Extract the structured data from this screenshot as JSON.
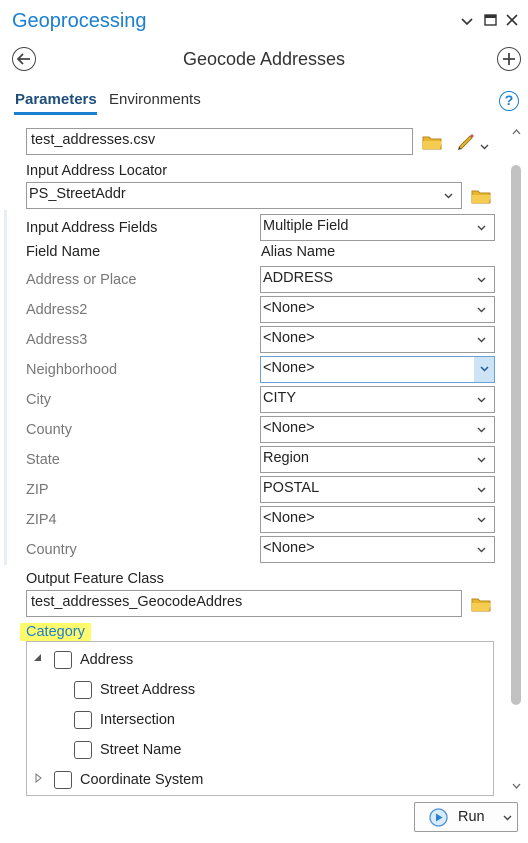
{
  "pane": {
    "title": "Geoprocessing",
    "tool_title": "Geocode Addresses"
  },
  "tabs": {
    "parameters": "Parameters",
    "environments": "Environments"
  },
  "help_glyph": "?",
  "form": {
    "input_table_value": "test_addresses.csv",
    "locator_label": "Input Address Locator",
    "locator_value": "PS_StreetAddr",
    "address_fields_label": "Input Address Fields",
    "address_fields_value": "Multiple Field",
    "field_name_header": "Field Name",
    "alias_name_header": "Alias Name",
    "fields": [
      {
        "name": "Address or Place",
        "alias": "ADDRESS"
      },
      {
        "name": "Address2",
        "alias": "<None>"
      },
      {
        "name": "Address3",
        "alias": "<None>"
      },
      {
        "name": "Neighborhood",
        "alias": "<None>"
      },
      {
        "name": "City",
        "alias": "CITY"
      },
      {
        "name": "County",
        "alias": "<None>"
      },
      {
        "name": "State",
        "alias": "Region"
      },
      {
        "name": "ZIP",
        "alias": "POSTAL"
      },
      {
        "name": "ZIP4",
        "alias": "<None>"
      },
      {
        "name": "Country",
        "alias": "<None>"
      }
    ],
    "output_label": "Output Feature Class",
    "output_value": "test_addresses_GeocodeAddres",
    "category_label": "Category",
    "categories": [
      {
        "label": "Address",
        "level": 0,
        "expander": "expanded"
      },
      {
        "label": "Street Address",
        "level": 1
      },
      {
        "label": "Intersection",
        "level": 1
      },
      {
        "label": "Street Name",
        "level": 1
      },
      {
        "label": "Coordinate System",
        "level": 0,
        "expander": "collapsed"
      }
    ]
  },
  "run_button": {
    "label": "Run"
  },
  "icons": [
    "back-icon",
    "add-icon",
    "folder-icon",
    "pencil-icon",
    "chevron-down-icon",
    "play-icon",
    "help-icon",
    "close-icon",
    "maximize-icon"
  ],
  "colors": {
    "accent": "#1a7fd0",
    "highlight": "#fffb6a",
    "folder": "#e8b730"
  }
}
